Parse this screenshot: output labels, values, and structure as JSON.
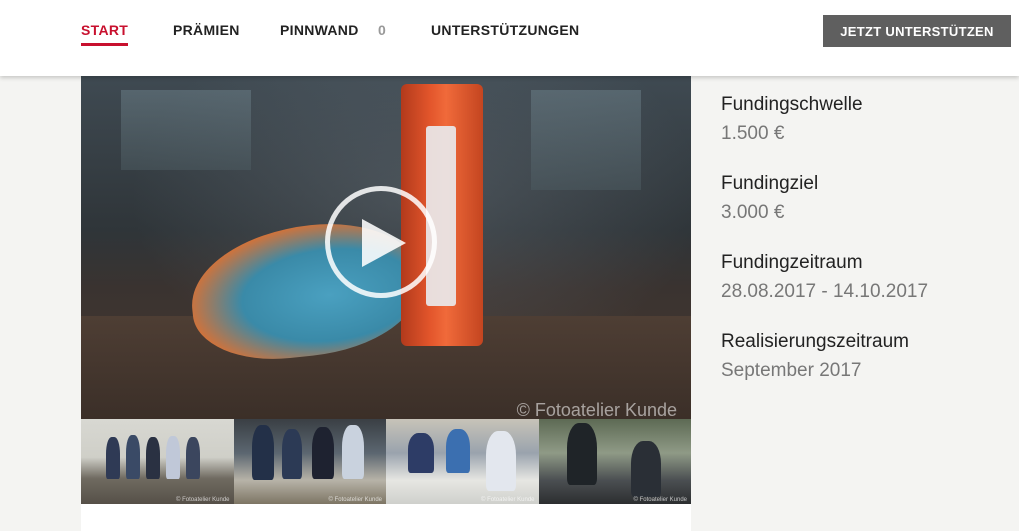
{
  "nav": {
    "items": [
      {
        "label": "START",
        "active": true
      },
      {
        "label": "PRÄMIEN"
      },
      {
        "label": "PINNWAND",
        "count": "0"
      },
      {
        "label": "UNTERSTÜTZUNGEN"
      }
    ],
    "cta_label": "JETZT UNTERSTÜTZEN"
  },
  "media": {
    "watermark": "© Fotoatelier Kunde",
    "thumb_caption": "© Fotoatelier Kunde"
  },
  "sidebar": {
    "stats": [
      {
        "label": "Fundingschwelle",
        "value": "1.500 €"
      },
      {
        "label": "Fundingziel",
        "value": "3.000 €"
      },
      {
        "label": "Fundingzeitraum",
        "value": "28.08.2017 - 14.10.2017"
      },
      {
        "label": "Realisierungszeitraum",
        "value": "September 2017"
      }
    ]
  },
  "colors": {
    "accent": "#c8102e",
    "cta_bg": "#5f5f5f",
    "page_bg": "#f4f4f2"
  }
}
